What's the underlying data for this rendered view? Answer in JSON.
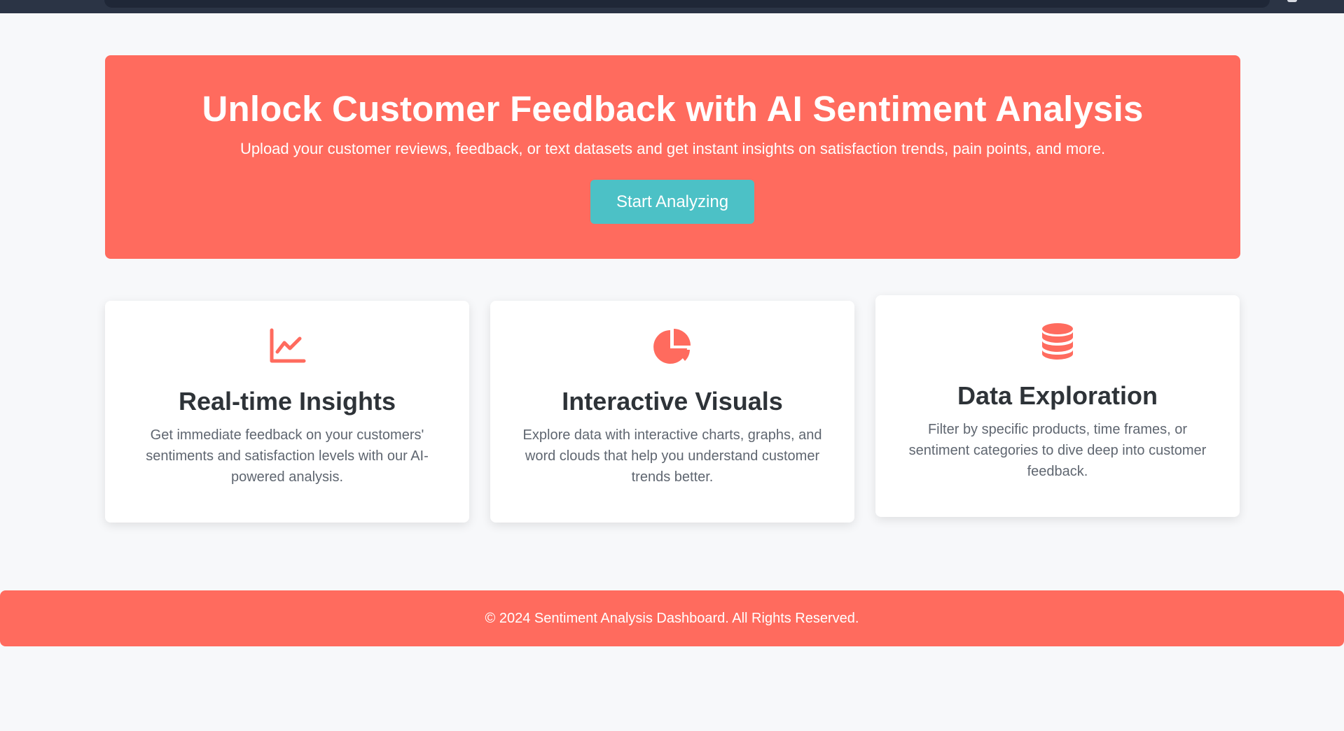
{
  "hero": {
    "title": "Unlock Customer Feedback with AI Sentiment Analysis",
    "subtitle": "Upload your customer reviews, feedback, or text datasets and get instant insights on satisfaction trends, pain points, and more.",
    "button_label": "Start Analyzing"
  },
  "features": [
    {
      "icon": "line-chart-icon",
      "title": "Real-time Insights",
      "description": "Get immediate feedback on your customers' sentiments and satisfaction levels with our AI-powered analysis."
    },
    {
      "icon": "pie-chart-icon",
      "title": "Interactive Visuals",
      "description": "Explore data with interactive charts, graphs, and word clouds that help you understand customer trends better."
    },
    {
      "icon": "database-icon",
      "title": "Data Exploration",
      "description": "Filter by specific products, time frames, or sentiment categories to dive deep into customer feedback."
    }
  ],
  "footer": {
    "text": "© 2024 Sentiment Analysis Dashboard. All Rights Reserved."
  },
  "colors": {
    "accent": "#ff6b5e",
    "button": "#4cc1c6",
    "background": "#f7f8fa",
    "topbar": "#2b3445"
  }
}
